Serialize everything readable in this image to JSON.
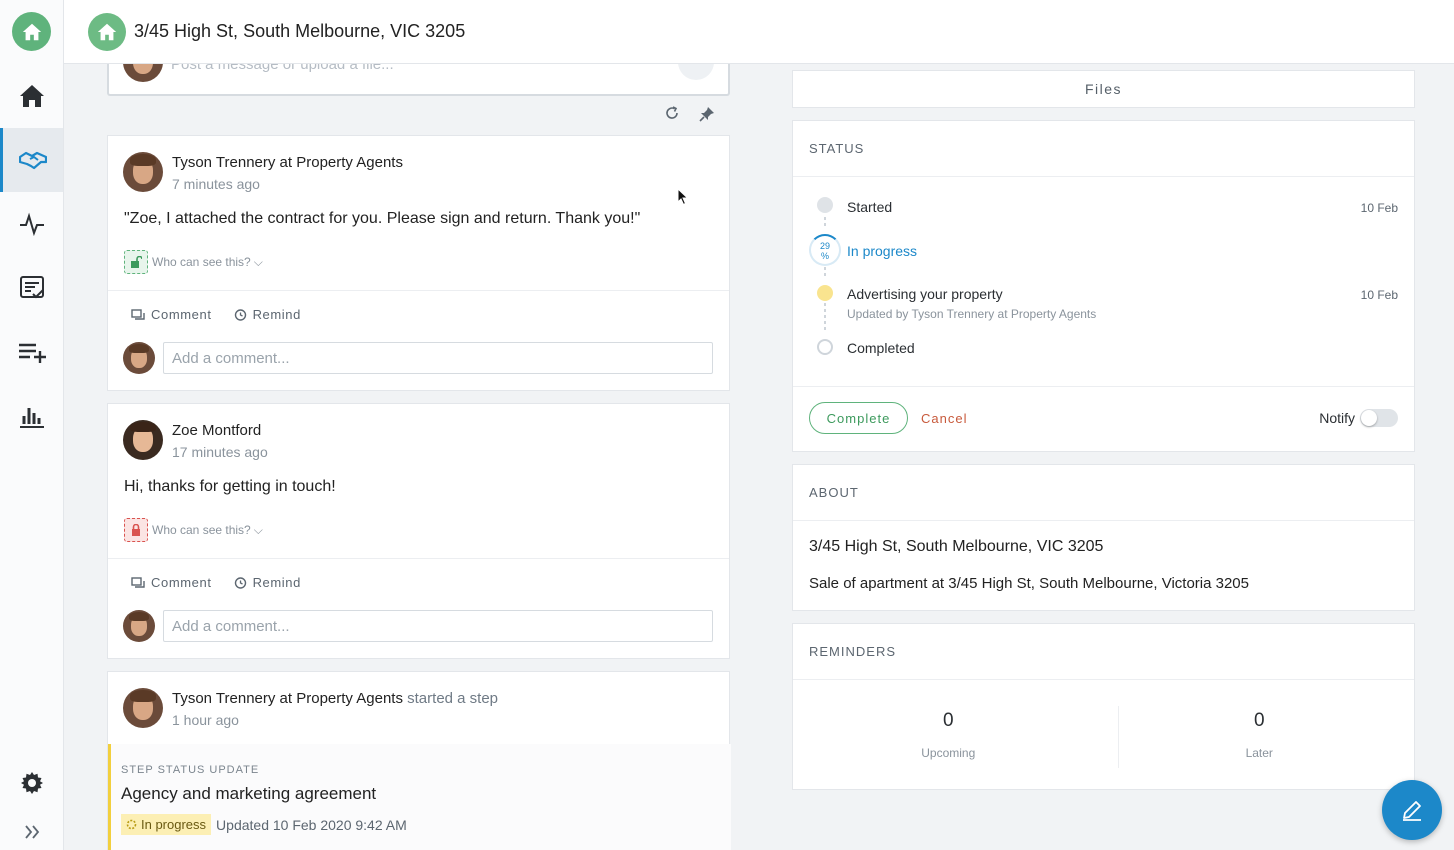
{
  "header": {
    "title": "3/45 High St, South Melbourne, VIC 3205"
  },
  "composer": {
    "placeholder": "Post a message or upload a file..."
  },
  "posts": [
    {
      "author": "Tyson Trennery at Property Agents",
      "time": "7 minutes ago",
      "body": "\"Zoe, I attached the contract for you. Please sign and return. Thank you!\"",
      "visibility": "Who can see this?",
      "comment_label": "Comment",
      "remind_label": "Remind",
      "comment_placeholder": "Add a comment..."
    },
    {
      "author": "Zoe Montford",
      "time": "17 minutes ago",
      "body": "Hi, thanks for getting in touch!",
      "visibility": "Who can see this?",
      "comment_label": "Comment",
      "remind_label": "Remind",
      "comment_placeholder": "Add a comment..."
    },
    {
      "author": "Tyson Trennery at Property Agents",
      "action": "started a step",
      "time": "1 hour ago",
      "step_label": "STEP STATUS UPDATE",
      "step_title": "Agency and marketing agreement",
      "status_badge": "In progress",
      "updated": "Updated 10 Feb 2020 9:42 AM"
    }
  ],
  "files": {
    "label": "Files"
  },
  "status": {
    "heading": "STATUS",
    "steps": [
      {
        "label": "Started",
        "date": "10 Feb"
      },
      {
        "label": "In progress",
        "percent": "29",
        "percent_sign": "%"
      },
      {
        "label": "Advertising your property",
        "sub": "Updated by Tyson Trennery at Property Agents",
        "date": "10 Feb"
      },
      {
        "label": "Completed"
      }
    ],
    "complete_label": "Complete",
    "cancel_label": "Cancel",
    "notify_label": "Notify",
    "notify_on": false
  },
  "about": {
    "heading": "ABOUT",
    "address": "3/45 High St, South Melbourne, VIC 3205",
    "description": "Sale of apartment at 3/45 High St, South Melbourne, Victoria 3205"
  },
  "reminders": {
    "heading": "REMINDERS",
    "upcoming_count": "0",
    "upcoming_label": "Upcoming",
    "later_count": "0",
    "later_label": "Later"
  },
  "colors": {
    "accent": "#1c88c9",
    "green": "#5fb37c",
    "cancel": "#c85a3c",
    "in_progress": "#f2cf3d"
  },
  "icons": [
    "home-icon",
    "handshake-icon",
    "activity-icon",
    "checklist-icon",
    "add-list-icon",
    "bar-chart-icon",
    "gear-icon",
    "expand-icon",
    "refresh-icon",
    "pin-icon",
    "edit-icon"
  ]
}
